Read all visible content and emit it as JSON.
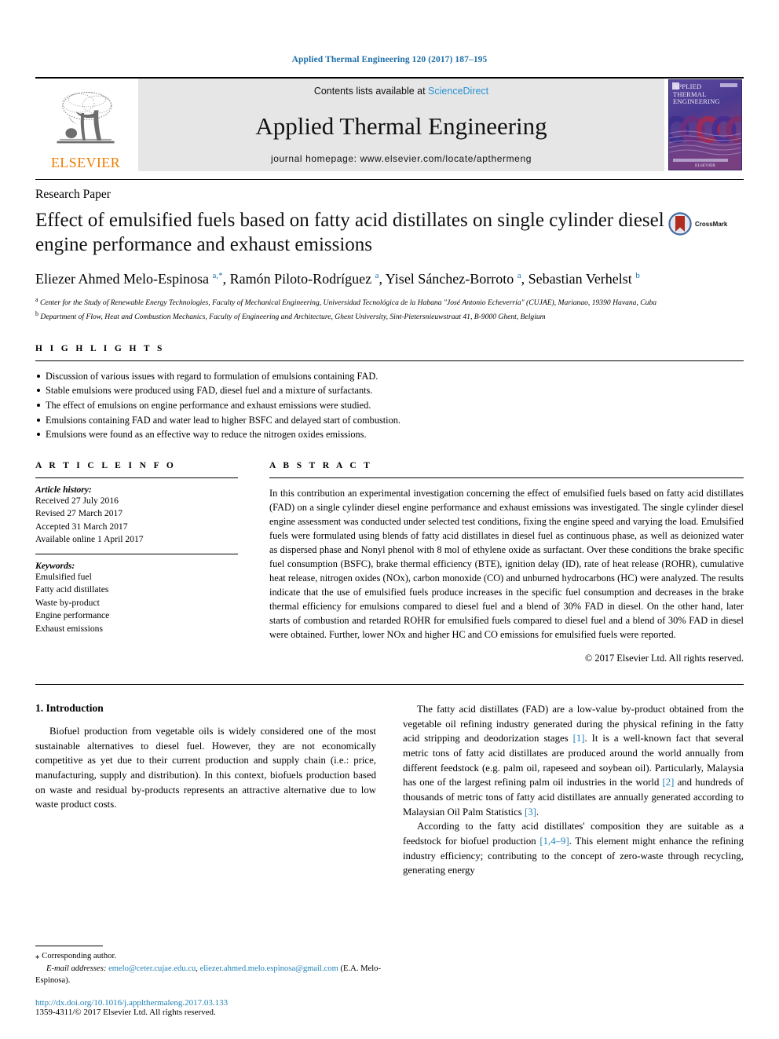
{
  "running_head": "Applied Thermal Engineering 120 (2017) 187–195",
  "masthead": {
    "contents_prefix": "Contents lists available at ",
    "sciencedirect": "ScienceDirect",
    "journal_title": "Applied Thermal Engineering",
    "homepage": "journal homepage: www.elsevier.com/locate/apthermeng",
    "publisher_wordmark": "ELSEVIER",
    "cover_title_line1": "APPLIED",
    "cover_title_line2": "THERMAL",
    "cover_title_line3": "ENGINEERING",
    "cover_footer": "ELSEVIER"
  },
  "article": {
    "type": "Research Paper",
    "title": "Effect of emulsified fuels based on fatty acid distillates on single cylinder diesel engine performance and exhaust emissions",
    "crossmark_label": "CrossMark",
    "authors_html": "Eliezer Ahmed Melo-Espinosa <sup>a,*</sup>, Ramón Piloto-Rodríguez <sup>a</sup>, Yisel Sánchez-Borroto <sup>a</sup>, Sebastian Verhelst <sup>b</sup>",
    "affiliations": [
      "a Center for the Study of Renewable Energy Technologies, Faculty of Mechanical Engineering, Universidad Tecnológica de la Habana \"José Antonio Echeverría\" (CUJAE), Marianao, 19390 Havana, Cuba",
      "b Department of Flow, Heat and Combustion Mechanics, Faculty of Engineering and Architecture, Ghent University, Sint-Pietersnieuwstraat 41, B-9000 Ghent, Belgium"
    ]
  },
  "highlights": {
    "label": "H I G H L I G H T S",
    "items": [
      "Discussion of various issues with regard to formulation of emulsions containing FAD.",
      "Stable emulsions were produced using FAD, diesel fuel and a mixture of surfactants.",
      "The effect of emulsions on engine performance and exhaust emissions were studied.",
      "Emulsions containing FAD and water lead to higher BSFC and delayed start of combustion.",
      "Emulsions were found as an effective way to reduce the nitrogen oxides emissions."
    ]
  },
  "article_info": {
    "label": "A R T I C L E   I N F O",
    "history_label": "Article history:",
    "history": [
      "Received 27 July 2016",
      "Revised 27 March 2017",
      "Accepted 31 March 2017",
      "Available online 1 April 2017"
    ],
    "keywords_label": "Keywords:",
    "keywords": [
      "Emulsified fuel",
      "Fatty acid distillates",
      "Waste by-product",
      "Engine performance",
      "Exhaust emissions"
    ]
  },
  "abstract": {
    "label": "A B S T R A C T",
    "text": "In this contribution an experimental investigation concerning the effect of emulsified fuels based on fatty acid distillates (FAD) on a single cylinder diesel engine performance and exhaust emissions was investigated. The single cylinder diesel engine assessment was conducted under selected test conditions, fixing the engine speed and varying the load. Emulsified fuels were formulated using blends of fatty acid distillates in diesel fuel as continuous phase, as well as deionized water as dispersed phase and Nonyl phenol with 8 mol of ethylene oxide as surfactant. Over these conditions the brake specific fuel consumption (BSFC), brake thermal efficiency (BTE), ignition delay (ID), rate of heat release (ROHR), cumulative heat release, nitrogen oxides (NOx), carbon monoxide (CO) and unburned hydrocarbons (HC) were analyzed. The results indicate that the use of emulsified fuels produce increases in the specific fuel consumption and decreases in the brake thermal efficiency for emulsions compared to diesel fuel and a blend of 30% FAD in diesel. On the other hand, later starts of combustion and retarded ROHR for emulsified fuels compared to diesel fuel and a blend of 30% FAD in diesel were obtained. Further, lower NOx and higher HC and CO emissions for emulsified fuels were reported.",
    "copyright": "© 2017 Elsevier Ltd. All rights reserved."
  },
  "body": {
    "section_heading": "1. Introduction",
    "left_paragraphs": [
      "Biofuel production from vegetable oils is widely considered one of the most sustainable alternatives to diesel fuel. However, they are not economically competitive as yet due to their current production and supply chain (i.e.: price, manufacturing, supply and distribution). In this context, biofuels production based on waste and residual by-products represents an attractive alternative due to low waste product costs."
    ],
    "right_paragraphs_html": [
      "The fatty acid distillates (FAD) are a low-value by-product obtained from the vegetable oil refining industry generated during the physical refining in the fatty acid stripping and deodorization stages <span class=\"ref\">[1]</span>. It is a well-known fact that several metric tons of fatty acid distillates are produced around the world annually from different feedstock (e.g. palm oil, rapeseed and soybean oil). Particularly, Malaysia has one of the largest refining palm oil industries in the world <span class=\"ref\">[2]</span> and hundreds of thousands of metric tons of fatty acid distillates are annually generated according to Malaysian Oil Palm Statistics <span class=\"ref\">[3]</span>.",
      "According to the fatty acid distillates' composition they are suitable as a feedstock for biofuel production <span class=\"ref\">[1,4–9]</span>. This element might enhance the refining industry efficiency; contributing to the concept of zero-waste through recycling, generating energy"
    ]
  },
  "footnote": {
    "corresponding": "Corresponding author.",
    "star": "⁎",
    "email_label": "E-mail addresses:",
    "email1": "emelo@ceter.cujae.edu.cu",
    "email2": "eliezer.ahmed.melo.espinosa@gmail.com",
    "email_owner": "(E.A. Melo-Espinosa).",
    "doi": "http://dx.doi.org/10.1016/j.applthermaleng.2017.03.133",
    "issn": "1359-4311/© 2017 Elsevier Ltd. All rights reserved."
  },
  "colors": {
    "link_blue": "#1f7fb5",
    "sciencedirect_blue": "#2a93d5",
    "elsevier_orange": "#ef7d00",
    "masthead_grey": "#e6e6e6"
  }
}
